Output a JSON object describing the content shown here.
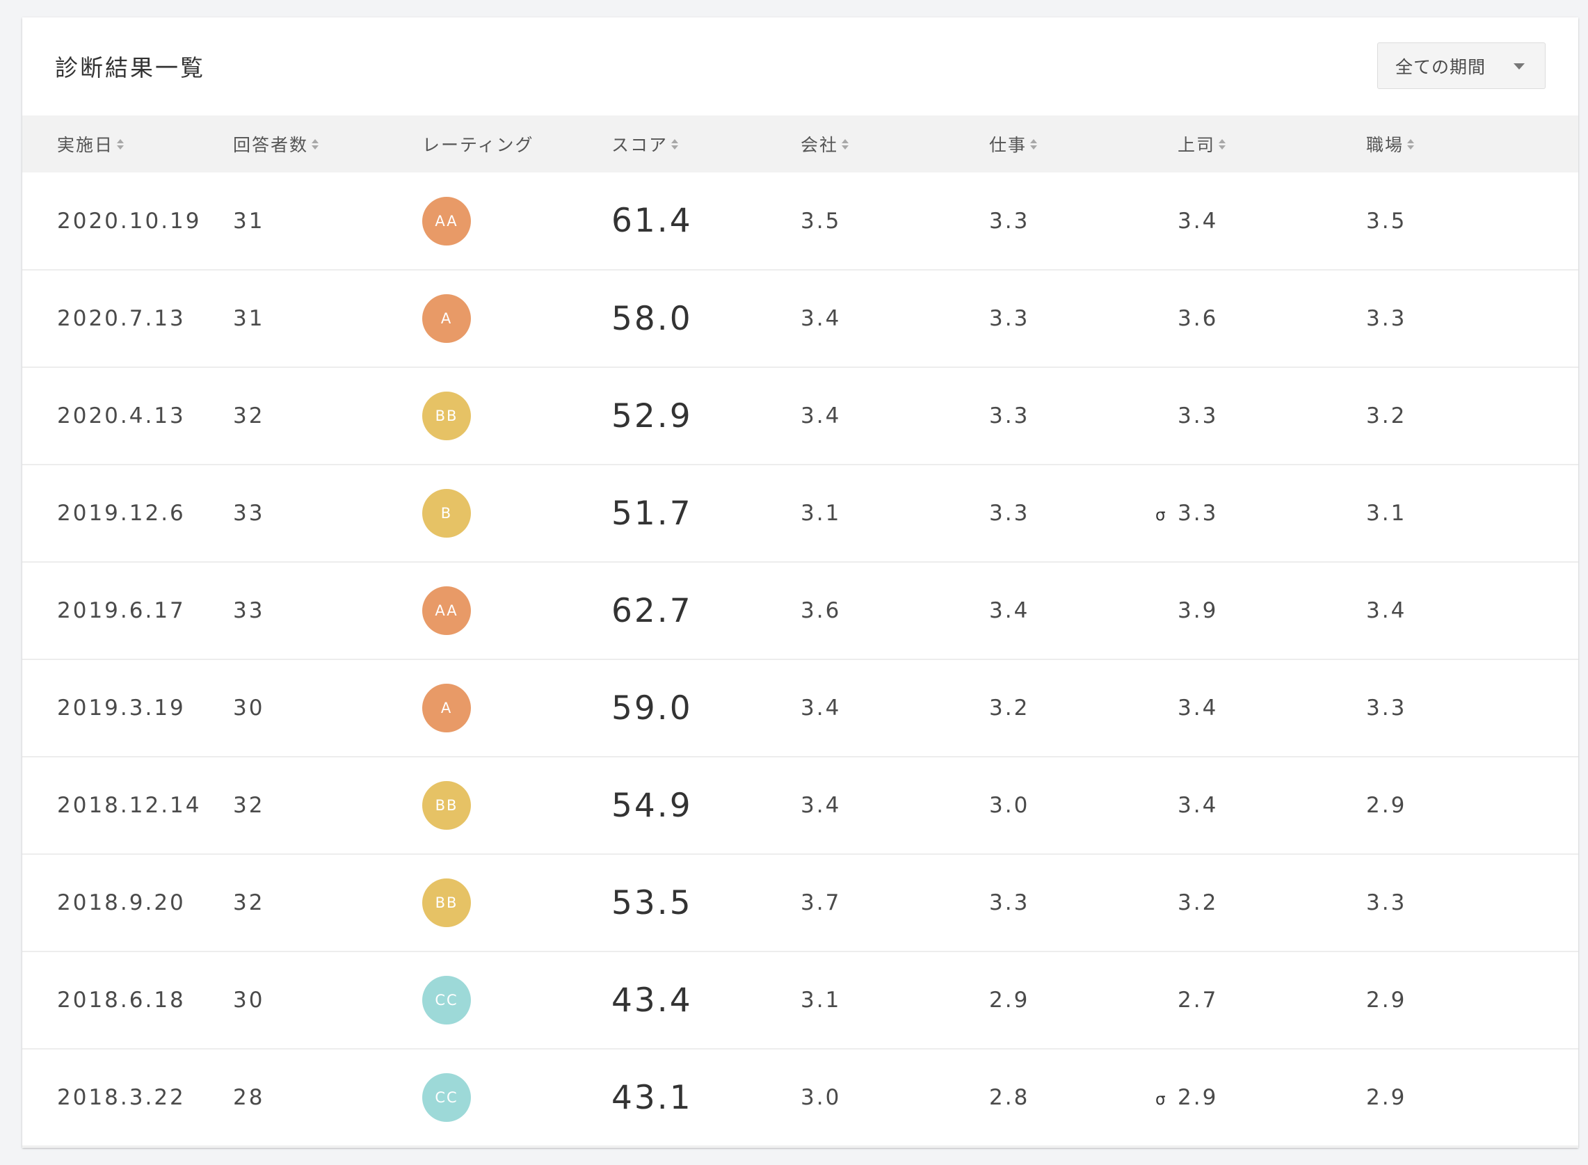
{
  "title": "診断結果一覧",
  "period_select": {
    "value": "全ての期間"
  },
  "columns": [
    {
      "label": "実施日",
      "sortable": true
    },
    {
      "label": "回答者数",
      "sortable": true
    },
    {
      "label": "レーティング",
      "sortable": false
    },
    {
      "label": "スコア",
      "sortable": true
    },
    {
      "label": "会社",
      "sortable": true
    },
    {
      "label": "仕事",
      "sortable": true
    },
    {
      "label": "上司",
      "sortable": true
    },
    {
      "label": "職場",
      "sortable": true
    }
  ],
  "rating_colors": {
    "AA": "#e89a67",
    "A": "#e89a67",
    "BB": "#e6c265",
    "B": "#e6c265",
    "CC": "#9dd9d8"
  },
  "rows": [
    {
      "date": "2020.10.19",
      "respondents": "31",
      "rating": "AA",
      "score": "61.4",
      "company": "3.5",
      "work": "3.3",
      "boss_sigma": "",
      "boss": "3.4",
      "workplace": "3.5"
    },
    {
      "date": "2020.7.13",
      "respondents": "31",
      "rating": "A",
      "score": "58.0",
      "company": "3.4",
      "work": "3.3",
      "boss_sigma": "",
      "boss": "3.6",
      "workplace": "3.3"
    },
    {
      "date": "2020.4.13",
      "respondents": "32",
      "rating": "BB",
      "score": "52.9",
      "company": "3.4",
      "work": "3.3",
      "boss_sigma": "",
      "boss": "3.3",
      "workplace": "3.2"
    },
    {
      "date": "2019.12.6",
      "respondents": "33",
      "rating": "B",
      "score": "51.7",
      "company": "3.1",
      "work": "3.3",
      "boss_sigma": "σ",
      "boss": "3.3",
      "workplace": "3.1"
    },
    {
      "date": "2019.6.17",
      "respondents": "33",
      "rating": "AA",
      "score": "62.7",
      "company": "3.6",
      "work": "3.4",
      "boss_sigma": "",
      "boss": "3.9",
      "workplace": "3.4"
    },
    {
      "date": "2019.3.19",
      "respondents": "30",
      "rating": "A",
      "score": "59.0",
      "company": "3.4",
      "work": "3.2",
      "boss_sigma": "",
      "boss": "3.4",
      "workplace": "3.3"
    },
    {
      "date": "2018.12.14",
      "respondents": "32",
      "rating": "BB",
      "score": "54.9",
      "company": "3.4",
      "work": "3.0",
      "boss_sigma": "",
      "boss": "3.4",
      "workplace": "2.9"
    },
    {
      "date": "2018.9.20",
      "respondents": "32",
      "rating": "BB",
      "score": "53.5",
      "company": "3.7",
      "work": "3.3",
      "boss_sigma": "",
      "boss": "3.2",
      "workplace": "3.3"
    },
    {
      "date": "2018.6.18",
      "respondents": "30",
      "rating": "CC",
      "score": "43.4",
      "company": "3.1",
      "work": "2.9",
      "boss_sigma": "",
      "boss": "2.7",
      "workplace": "2.9"
    },
    {
      "date": "2018.3.22",
      "respondents": "28",
      "rating": "CC",
      "score": "43.1",
      "company": "3.0",
      "work": "2.8",
      "boss_sigma": "σ",
      "boss": "2.9",
      "workplace": "2.9"
    }
  ]
}
